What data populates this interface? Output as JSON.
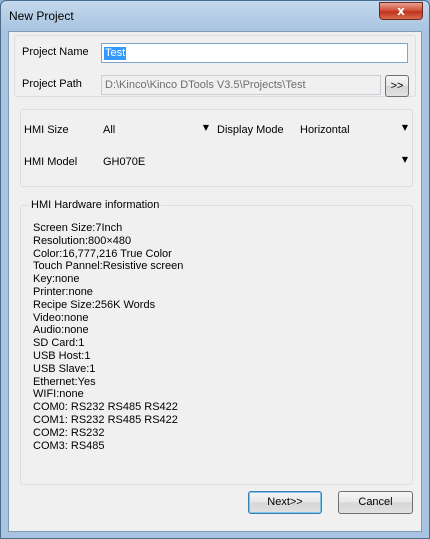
{
  "window": {
    "title": "New Project",
    "close_glyph": "x"
  },
  "project": {
    "name_label": "Project Name",
    "name_value": "Test",
    "path_label": "Project Path",
    "path_value": "D:\\Kinco\\Kinco DTools V3.5\\Projects\\Test",
    "browse_label": ">>"
  },
  "hmi": {
    "size_label": "HMI Size",
    "size_value": "All",
    "display_mode_label": "Display Mode",
    "display_mode_value": "Horizontal",
    "model_label": "HMI Model",
    "model_value": "GH070E"
  },
  "hardware": {
    "legend": "HMI Hardware information",
    "lines": [
      "Screen Size:7Inch",
      "Resolution:800×480",
      "Color:16,777,216 True Color",
      "Touch Pannel:Resistive screen",
      "Key:none",
      "Printer:none",
      "Recipe Size:256K Words",
      "Video:none",
      "Audio:none",
      "SD Card:1",
      "USB Host:1",
      "USB Slave:1",
      "Ethernet:Yes",
      "WIFI:none",
      "COM0: RS232 RS485 RS422",
      "COM1: RS232 RS485 RS422",
      "COM2: RS232",
      "COM3: RS485"
    ]
  },
  "buttons": {
    "next_label": "Next>>",
    "cancel_label": "Cancel"
  },
  "icons": {
    "dropdown": "chevron-down-icon",
    "close": "close-icon"
  }
}
